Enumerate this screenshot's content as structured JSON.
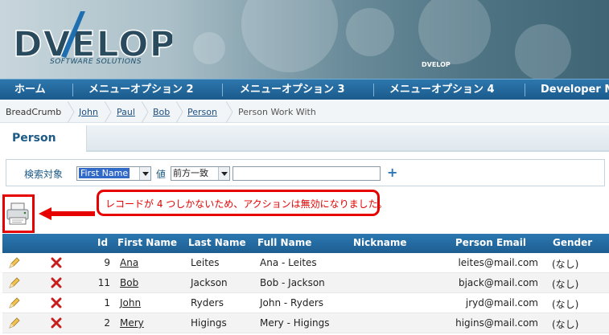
{
  "header": {
    "logo_text": "DVELOP",
    "logo_subtitle": "SOFTWARE SOLUTIONS",
    "mini_logo_text": "DVELOP",
    "bg_color": "#5e8393"
  },
  "menu": {
    "items": [
      {
        "label": "ホーム"
      },
      {
        "label": "メニューオプション 2"
      },
      {
        "label": "メニューオプション 3"
      },
      {
        "label": "メニューオプション 4"
      },
      {
        "label": "Developer M"
      }
    ],
    "bg_color": "#1f6097"
  },
  "breadcrumb": {
    "items": [
      {
        "label": "BreadCrumb"
      },
      {
        "label": "John"
      },
      {
        "label": "Paul"
      },
      {
        "label": "Bob"
      },
      {
        "label": "Person"
      },
      {
        "label": "Person Work With"
      }
    ]
  },
  "page": {
    "title": "Person"
  },
  "search": {
    "target_label": "検索対象",
    "target_value": "First Name",
    "value_label": "値",
    "operator_value": "前方一致",
    "input_value": "",
    "add_icon": "plus-icon"
  },
  "message": {
    "text": "レコードが 4 つしかないため、アクションは無効になりました。",
    "color": "#e60000"
  },
  "table": {
    "columns": [
      "Id",
      "First Name",
      "Last Name",
      "Full Name",
      "Nickname",
      "Person Email",
      "Gender"
    ],
    "rows": [
      {
        "id": "9",
        "first": "Ana",
        "last": "Leites",
        "full": "Ana - Leites",
        "nick": "",
        "email": "leites@mail.com",
        "gender": "(なし)"
      },
      {
        "id": "11",
        "first": "Bob",
        "last": "Jackson",
        "full": "Bob - Jackson",
        "nick": "",
        "email": "bjack@mail.com",
        "gender": "(なし)"
      },
      {
        "id": "1",
        "first": "John",
        "last": "Ryders",
        "full": "John - Ryders",
        "nick": "",
        "email": "jryd@mail.com",
        "gender": "(なし)"
      },
      {
        "id": "2",
        "first": "Mery",
        "last": "Higings",
        "full": "Mery - Higings",
        "nick": "",
        "email": "higins@mail.com",
        "gender": "(なし)"
      }
    ],
    "header_color": "#1f6097"
  }
}
